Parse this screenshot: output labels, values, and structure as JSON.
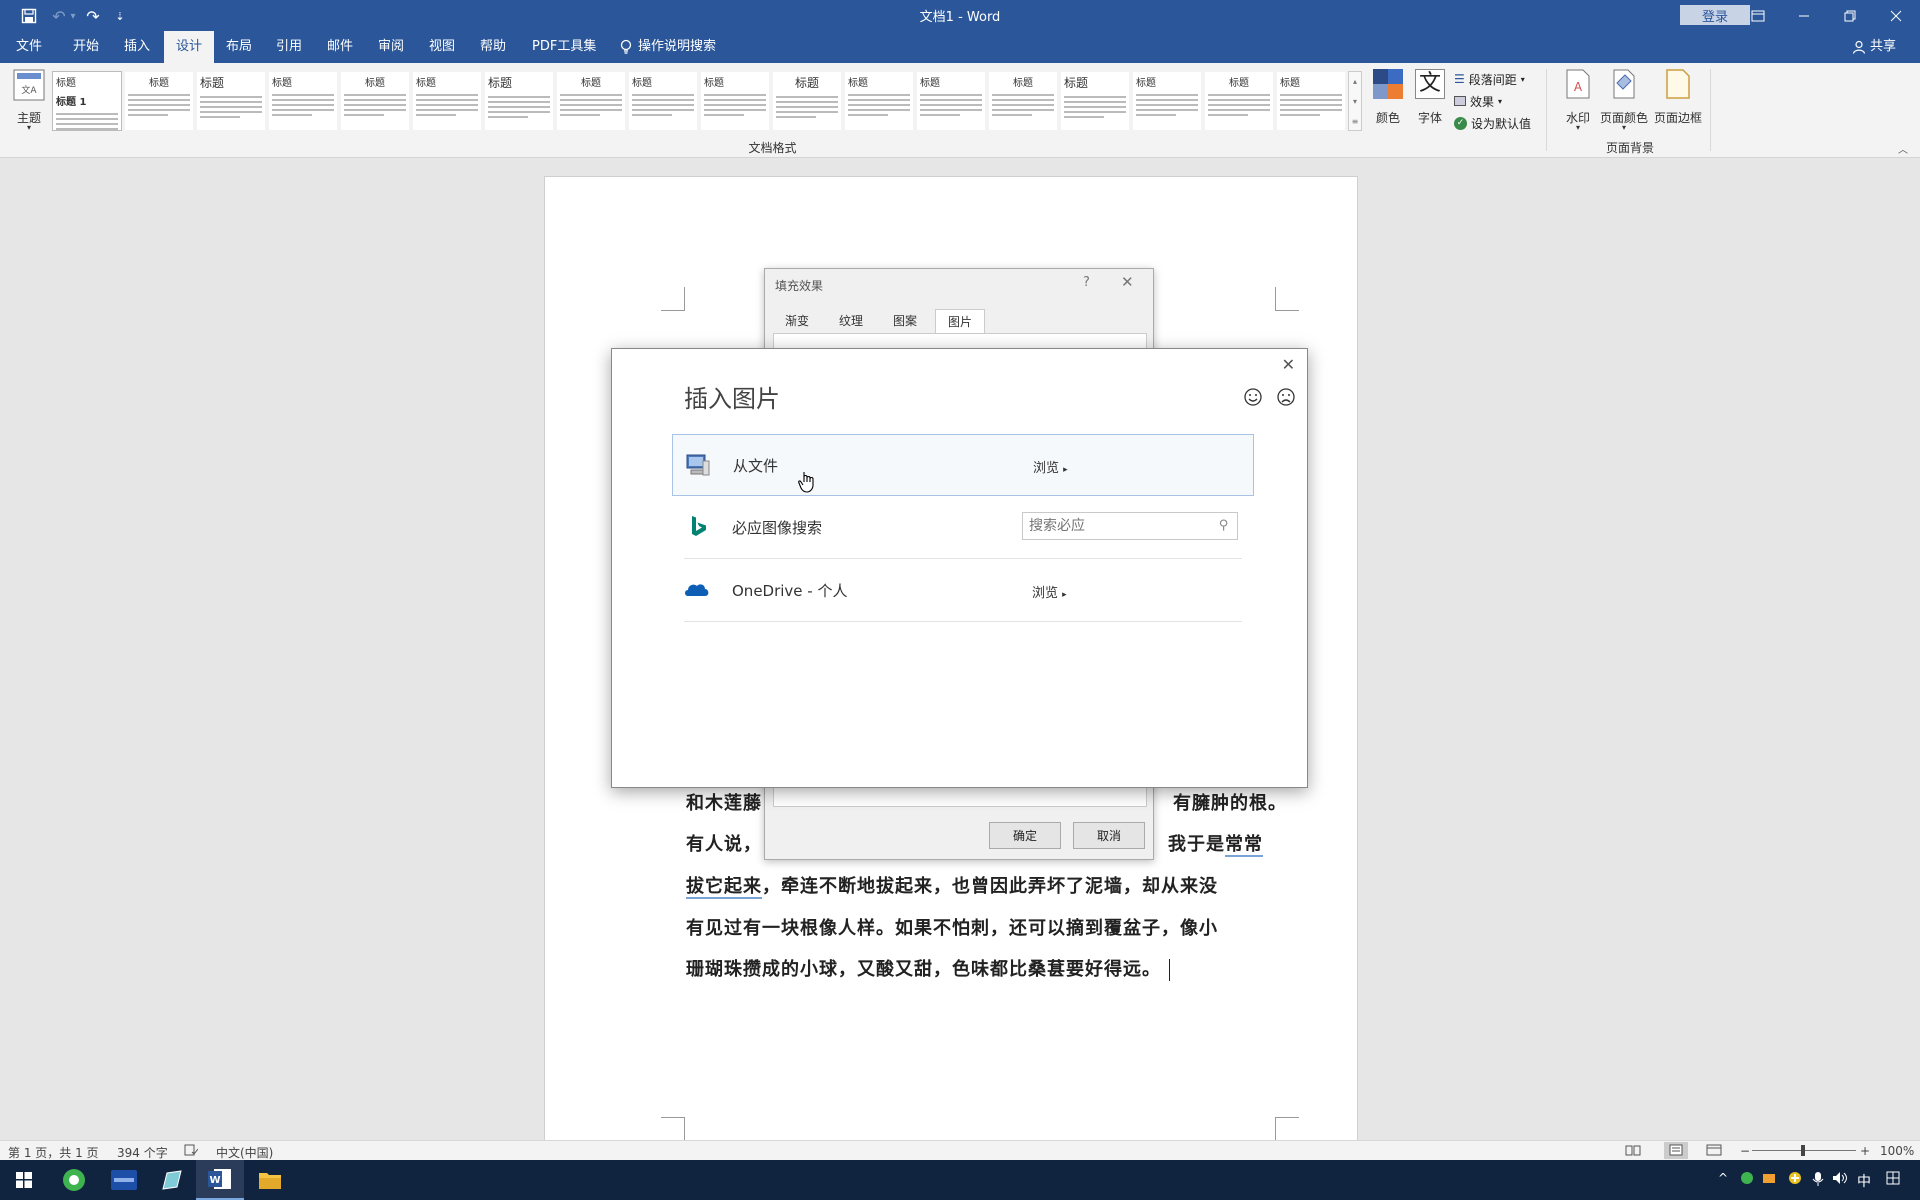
{
  "titlebar": {
    "doc_title": "文档1 - Word",
    "login": "登录",
    "customize_glyph": "⇣",
    "icons": [
      "save-icon",
      "undo-icon",
      "redo-icon",
      "customize-icon",
      "ribbon-display-icon",
      "minimize-icon",
      "restore-icon",
      "close-icon"
    ]
  },
  "menu": {
    "tabs": [
      "文件",
      "开始",
      "插入",
      "设计",
      "布局",
      "引用",
      "邮件",
      "审阅",
      "视图",
      "帮助",
      "PDF工具集"
    ],
    "active_index": 3,
    "search": "操作说明搜索",
    "share": "共享"
  },
  "ribbon": {
    "theme": "主题",
    "styles_group": "文档格式",
    "style_headings": [
      "标题",
      "标题",
      "标题",
      "标题",
      "标题",
      "标题",
      "标题",
      "标题",
      "标题",
      "标题",
      "标题",
      "标题",
      "标题",
      "标题",
      "标题",
      "标题",
      "标题",
      "标题"
    ],
    "style_subheading": "标题 1",
    "colors": "颜色",
    "fonts": "字体",
    "fonts_glyph": "文",
    "paragraph_spacing": "段落间距",
    "effects": "效果",
    "set_default": "设为默认值",
    "watermark": "水印",
    "page_color": "页面颜色",
    "page_borders": "页面边框",
    "page_bg_group": "页面背景"
  },
  "document": {
    "line1": "和木莲藤",
    "line1_end": "有臃肿的根。",
    "line2": "有人说，",
    "line2_end_a": "我于是",
    "line2_end_b": "常常",
    "line3_a": "拔它起来",
    "line3_b": "，牵连不断地拔起来，也曾因此弄坏了泥墙，却从来没",
    "line4": "有见过有一块根像人样。如果不怕刺，还可以摘到覆盆子，像小",
    "line5": "珊瑚珠攒成的小球，又酸又甜，色味都比桑葚要好得远。"
  },
  "fill_dialog": {
    "title": "填充效果",
    "help": "?",
    "tabs": [
      "渐变",
      "纹理",
      "图案",
      "图片"
    ],
    "active_tab": 3,
    "ok": "确定",
    "cancel": "取消"
  },
  "insert_dialog": {
    "title": "插入图片",
    "rows": [
      {
        "label": "从文件",
        "action": "浏览"
      },
      {
        "label": "必应图像搜索",
        "placeholder": "搜索必应"
      },
      {
        "label": "OneDrive - 个人",
        "action": "浏览"
      }
    ]
  },
  "statusbar": {
    "page": "第 1 页，共 1 页",
    "words": "394 个字",
    "language": "中文(中国)",
    "zoom": "100%",
    "zoom_minus": "−",
    "zoom_plus": "+"
  },
  "taskbar": {
    "ime": "中",
    "tray_chevron": "^"
  },
  "colors": {
    "accent": "#2b579a",
    "ribbon_bg": "#f3f3f3",
    "taskbar": "#10233f"
  }
}
